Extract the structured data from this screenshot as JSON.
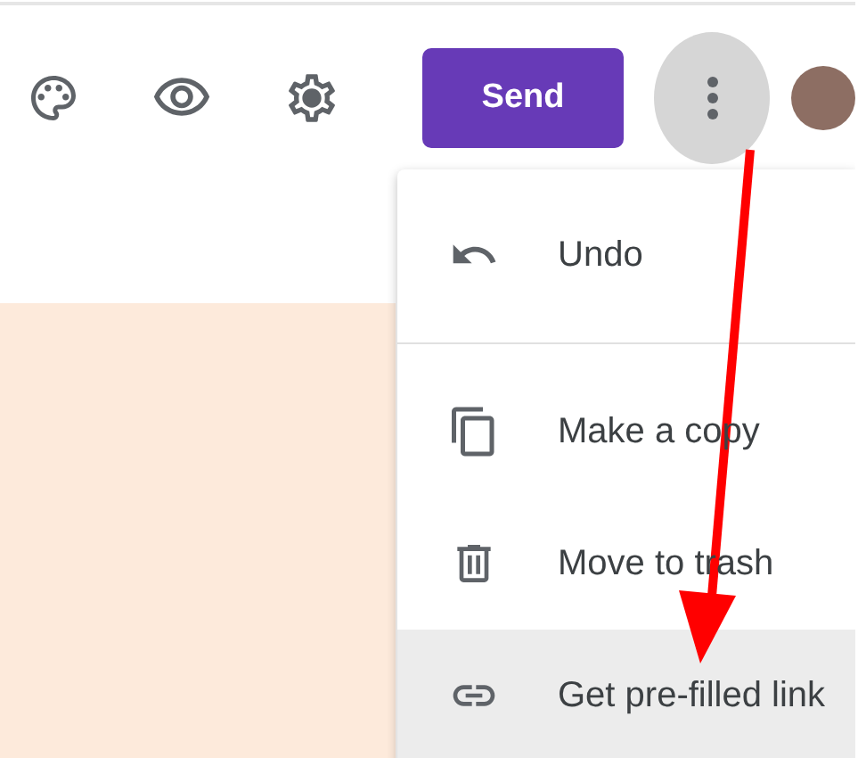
{
  "toolbar": {
    "send_button": "Send"
  },
  "menu": {
    "items": [
      {
        "kind": "undo",
        "label": "Undo",
        "highlighted": false
      },
      {
        "kind": "divider"
      },
      {
        "kind": "copy",
        "label": "Make a copy",
        "highlighted": false
      },
      {
        "kind": "trash",
        "label": "Move to trash",
        "highlighted": false
      },
      {
        "kind": "link",
        "label": "Get pre-filled link",
        "highlighted": true
      }
    ]
  }
}
